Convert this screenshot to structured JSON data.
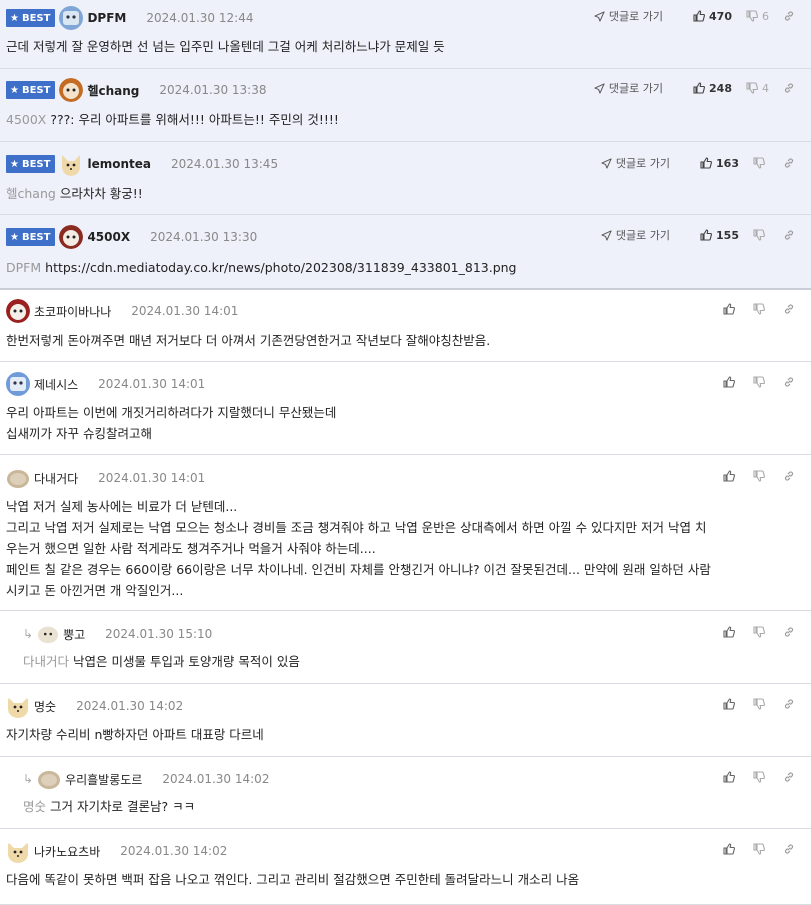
{
  "ui": {
    "best_label": "BEST",
    "goto_label": "댓글로 가기"
  },
  "comments": [
    {
      "nick": "DPFM",
      "date": "2024.01.30 12:44",
      "up": "470",
      "down": "6",
      "ref": "",
      "text": "근데 저렇게 잘 운영하면 선 넘는 입주민 나올텐데 그걸 어케 처리하느냐가 문제일 듯"
    },
    {
      "nick": "헬chang",
      "date": "2024.01.30 13:38",
      "up": "248",
      "down": "4",
      "ref": "4500X",
      "text": "???: 우리 아파트를 위해서!!! 아파트는!! 주민의 것!!!!"
    },
    {
      "nick": "lemontea",
      "date": "2024.01.30 13:45",
      "up": "163",
      "down": "",
      "ref": "헬chang",
      "text": "으라차차 황궁!!"
    },
    {
      "nick": "4500X",
      "date": "2024.01.30 13:30",
      "up": "155",
      "down": "",
      "ref": "DPFM",
      "text": "https://cdn.mediatoday.co.kr/news/photo/202308/311839_433801_813.png"
    },
    {
      "nick": "초코파이바나나",
      "date": "2024.01.30 14:01",
      "ref": "",
      "lines": [
        "한번저렇게 돈아껴주면 매년 저거보다 더 아껴서 기존껀당연한거고 작년보다 잘해야칭찬받음."
      ]
    },
    {
      "nick": "제네시스",
      "date": "2024.01.30 14:01",
      "ref": "",
      "lines": [
        "우리 아파트는 이번에 개짓거리하려다가 지랄했더니 무산됐는데",
        "십새끼가 자꾸 슈킹찰려고해"
      ]
    },
    {
      "nick": "다내거다",
      "date": "2024.01.30 14:01",
      "ref": "",
      "lines": [
        "낙엽 저거 실제 농사에는 비료가 더 낟텐데...",
        "그리고 낙엽 저거 실제로는 낙엽 모으는 청소나 경비들 조금 챙겨줘야 하고 낙엽 운반은 상대측에서 하면 아낄 수 있다지만 저거 낙엽 치",
        "우는거 했으면 일한 사람 적게라도 챙겨주거나 먹을거 사줘야 하는데....",
        "페인트 칠 같은 경우는 660이랑 66이랑은 너무 차이나네. 인건비 자체를 안챙긴거 아니냐? 이건 잘못된건데... 만약에 원래 일하던 사람",
        "시키고 돈 아낀거면 개 악질인거..."
      ]
    },
    {
      "nick": "뿡고",
      "date": "2024.01.30 15:10",
      "ref": "다내거다",
      "lines": [
        "낙엽은 미생물 투입과 토양개량 목적이 있음"
      ]
    },
    {
      "nick": "명숫",
      "date": "2024.01.30 14:02",
      "ref": "",
      "lines": [
        "자기차량 수리비 n빵하자던 아파트 대표랑 다르네"
      ]
    },
    {
      "nick": "우리흘발롱도르",
      "date": "2024.01.30 14:02",
      "ref": "명숫",
      "lines": [
        "그거 자기차로 결론남? ㅋㅋ"
      ]
    },
    {
      "nick": "나카노요츠바",
      "date": "2024.01.30 14:02",
      "ref": "",
      "lines": [
        "다음에 똑같이 못하면 백퍼 잡음 나오고 꺾인다. 그리고 관리비 절감했으면 주민한테 돌려달라느니 개소리 나옴"
      ]
    }
  ]
}
